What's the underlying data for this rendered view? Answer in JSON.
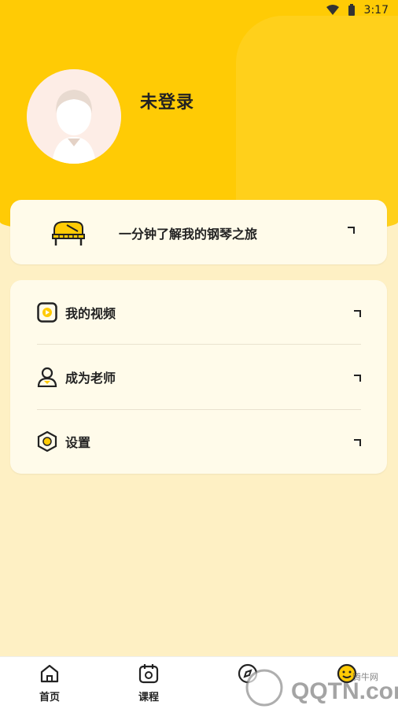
{
  "status_bar": {
    "time": "3:17",
    "icons": [
      "wifi-icon",
      "battery-icon"
    ]
  },
  "profile": {
    "username": "未登录",
    "avatar_icon": "default-avatar-icon"
  },
  "banner": {
    "label": "一分钟了解我的钢琴之旅",
    "icon": "grand-piano-icon",
    "arrow_icon": "chevron-right-icon"
  },
  "menu": {
    "items": [
      {
        "label": "我的视频",
        "icon": "video-icon"
      },
      {
        "label": "成为老师",
        "icon": "teacher-icon"
      },
      {
        "label": "设置",
        "icon": "settings-hexagon-icon"
      }
    ]
  },
  "tabs": [
    {
      "label": "首页",
      "icon": "home-icon"
    },
    {
      "label": "课程",
      "icon": "calendar-icon"
    },
    {
      "label": "",
      "icon": "discover-icon"
    },
    {
      "label": "",
      "icon": "profile-smile-icon"
    }
  ],
  "watermark": {
    "text": "QQTN.com",
    "subtext": "腾牛网"
  },
  "colors": {
    "header": "#FFCB05",
    "background": "#FEF0C4",
    "card": "#FFFBEA",
    "accent": "#FFCB05"
  }
}
